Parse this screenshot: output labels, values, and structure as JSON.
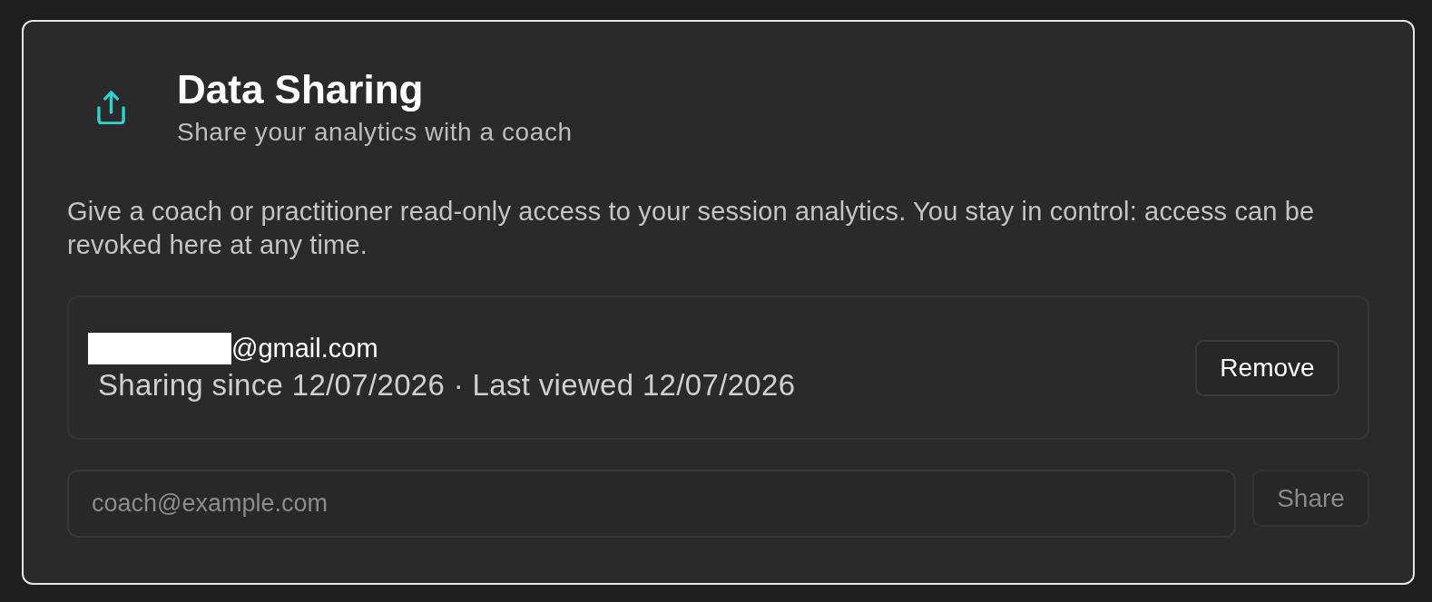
{
  "header": {
    "title": "Data Sharing",
    "subtitle": "Share your analytics with a coach"
  },
  "description": "Give a coach or practitioner read-only access to your session analytics. You stay in control: access can be revoked here at any time.",
  "shares": [
    {
      "email": "@gmail.com",
      "redacted": true,
      "meta": "Sharing since 12/07/2026 · Last viewed 12/07/2026",
      "action": {
        "label": "Remove",
        "disabled": false
      }
    }
  ],
  "invite": {
    "placeholder": "coach@example.com",
    "button": {
      "label": "Share",
      "disabled": true
    }
  }
}
